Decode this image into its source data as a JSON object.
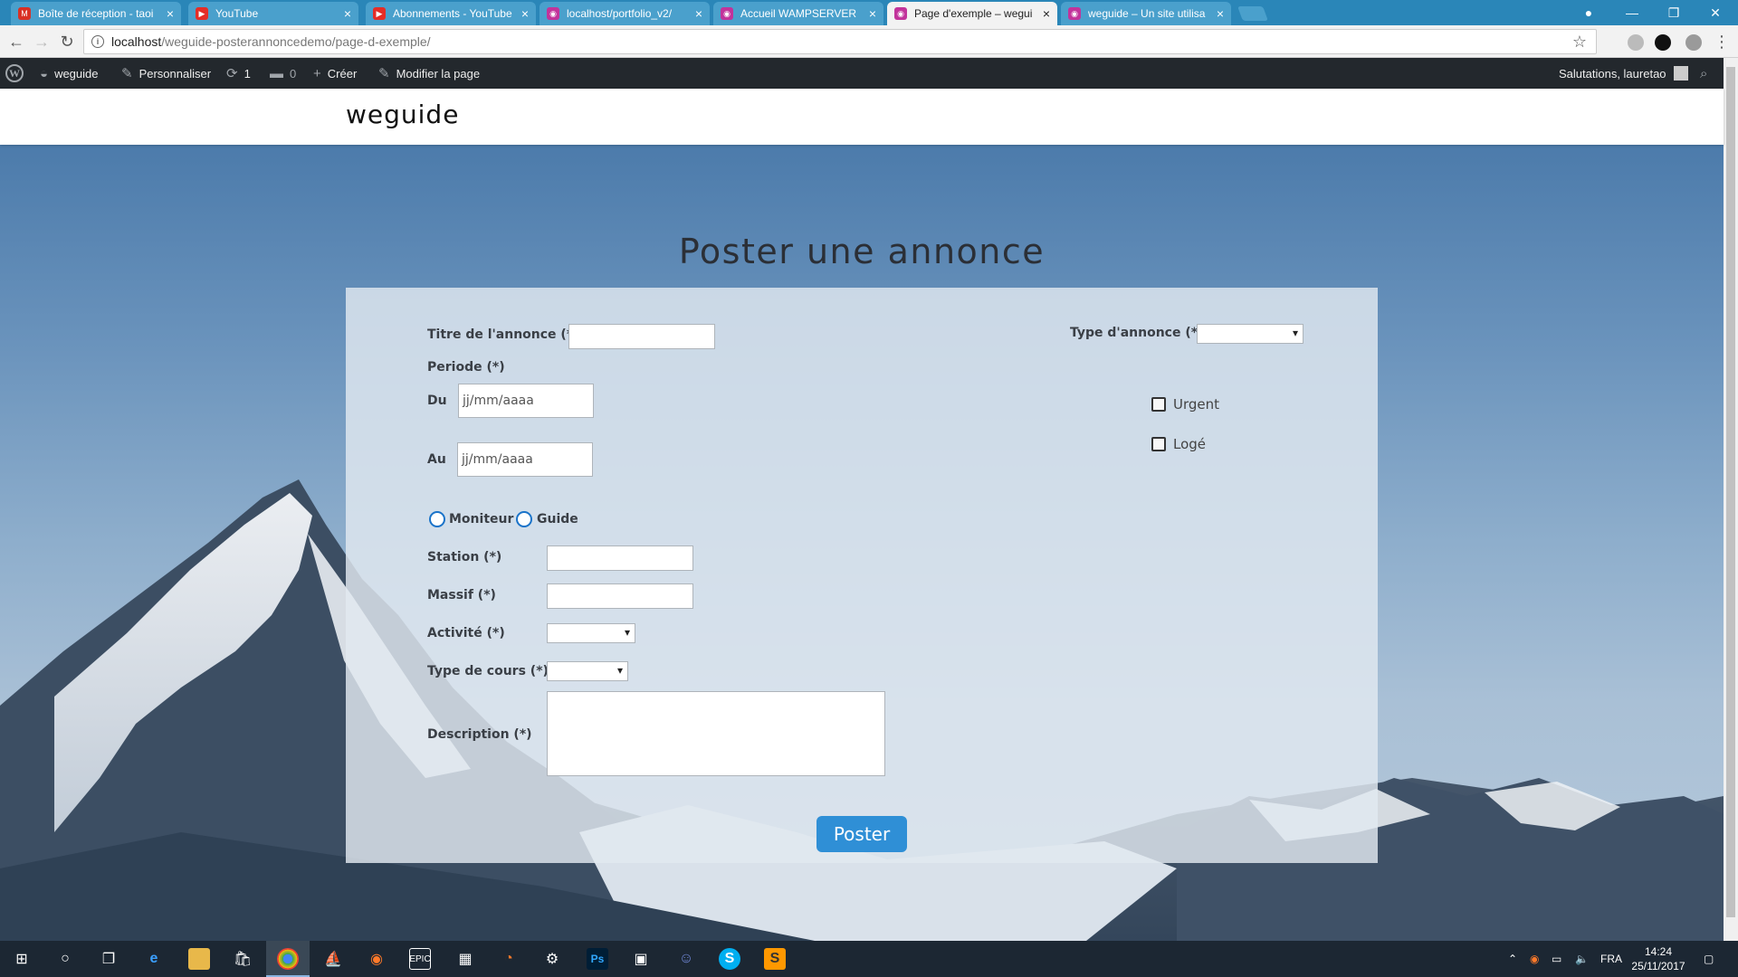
{
  "browser": {
    "tabs": [
      {
        "title": "Boîte de réception - taoi",
        "favicon_color": "#d93025",
        "favicon_glyph": "M"
      },
      {
        "title": "YouTube",
        "favicon_color": "#e52d27",
        "favicon_glyph": "▶"
      },
      {
        "title": "Abonnements - YouTube",
        "favicon_color": "#e52d27",
        "favicon_glyph": "▶"
      },
      {
        "title": "localhost/portfolio_v2/",
        "favicon_color": "#c2339b",
        "favicon_glyph": "◉"
      },
      {
        "title": "Accueil WAMPSERVER",
        "favicon_color": "#c2339b",
        "favicon_glyph": "◉"
      },
      {
        "title": "Page d'exemple – wegui",
        "favicon_color": "#c2339b",
        "favicon_glyph": "◉"
      },
      {
        "title": "weguide – Un site utilisa",
        "favicon_color": "#c2339b",
        "favicon_glyph": "◉"
      }
    ],
    "active_tab_index": 5,
    "url_host": "localhost",
    "url_path": "/weguide-posterannoncedemo/page-d-exemple/"
  },
  "adminbar": {
    "site_name": "weguide",
    "customize": "Personnaliser",
    "updates": "1",
    "comments": "0",
    "new": "Créer",
    "edit_page": "Modifier la page",
    "greeting": "Salutations, lauretao"
  },
  "site": {
    "title": "weguide"
  },
  "page": {
    "title": "Poster une annonce"
  },
  "form": {
    "titre_label": "Titre de l'annonce (*)",
    "titre_value": "",
    "type_label": "Type d'annonce (*)",
    "type_value": "",
    "periode_label": "Periode (*)",
    "du_label": "Du",
    "au_label": "Au",
    "date_placeholder": "jj/mm/aaaa",
    "urgent_label": "Urgent",
    "urgent_checked": false,
    "loge_label": "Logé",
    "loge_checked": false,
    "radio_moniteur": "Moniteur",
    "radio_guide": "Guide",
    "station_label": "Station (*)",
    "massif_label": "Massif (*)",
    "activite_label": "Activité (*)",
    "type_cours_label": "Type de cours (*)",
    "description_label": "Description (*)",
    "submit_label": "Poster"
  },
  "taskbar": {
    "language": "FRA",
    "time": "14:24",
    "date": "25/11/2017"
  }
}
